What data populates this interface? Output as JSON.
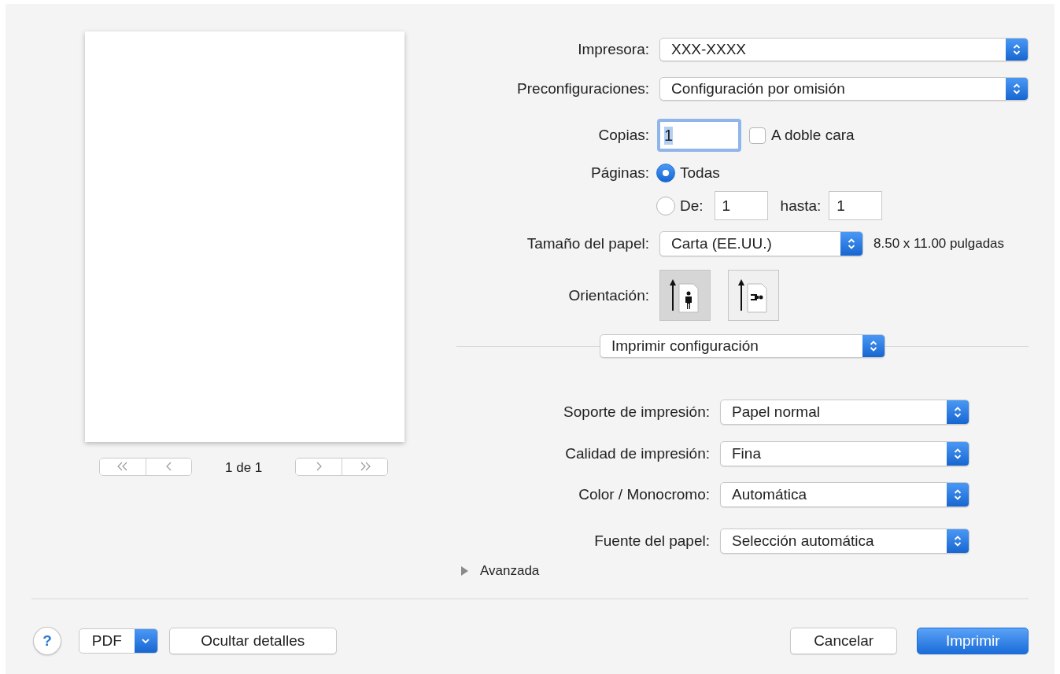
{
  "preview": {
    "page_label": "1 de 1"
  },
  "printer": {
    "label": "Impresora:",
    "value": "XXX-XXXX"
  },
  "presets": {
    "label": "Preconfiguraciones:",
    "value": "Configuración por omisión"
  },
  "copies": {
    "label": "Copias:",
    "value": "1",
    "duplex": {
      "label": "A doble cara",
      "checked": false
    }
  },
  "pages": {
    "label": "Páginas:",
    "options": [
      {
        "kind": "all",
        "label": "Todas",
        "selected": true
      },
      {
        "kind": "range",
        "label": "De:",
        "selected": false,
        "from": "1",
        "to_label": "hasta:",
        "to": "1"
      }
    ]
  },
  "paper_size": {
    "label": "Tamaño del papel:",
    "value": "Carta (EE.UU.)",
    "dimensions": "8.50 x 11.00 pulgadas"
  },
  "orientation": {
    "label": "Orientación:",
    "options": [
      {
        "kind": "portrait",
        "selected": true
      },
      {
        "kind": "landscape",
        "selected": false
      }
    ]
  },
  "section_menu": {
    "value": "Imprimir configuración"
  },
  "settings": [
    {
      "label": "Soporte de impresión:",
      "value": "Papel normal"
    },
    {
      "label": "Calidad de impresión:",
      "value": "Fina"
    },
    {
      "label": "Color / Monocromo:",
      "value": "Automática"
    },
    {
      "label": "Fuente del papel:",
      "value": "Selección automática"
    }
  ],
  "advanced": {
    "label": "Avanzada",
    "expanded": false
  },
  "footer": {
    "help": "?",
    "pdf": "PDF",
    "hide_details": "Ocultar detalles",
    "cancel": "Cancelar",
    "print": "Imprimir"
  }
}
